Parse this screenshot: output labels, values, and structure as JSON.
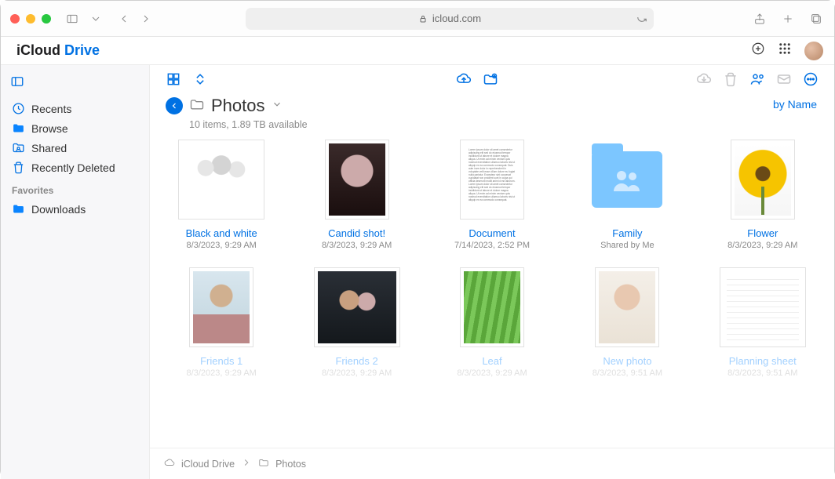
{
  "browser": {
    "address": "icloud.com"
  },
  "brand": {
    "word1": "iCloud",
    "word2": "Drive"
  },
  "sidebar": {
    "items": [
      {
        "label": "Recents"
      },
      {
        "label": "Browse"
      },
      {
        "label": "Shared"
      },
      {
        "label": "Recently Deleted"
      }
    ],
    "favorites_header": "Favorites",
    "favorites": [
      {
        "label": "Downloads"
      }
    ]
  },
  "page": {
    "title": "Photos",
    "subtitle": "10 items, 1.89 TB available",
    "sort_label": "by Name"
  },
  "files": [
    {
      "name": "Black and white",
      "meta": "8/3/2023, 9:29 AM"
    },
    {
      "name": "Candid shot!",
      "meta": "8/3/2023, 9:29 AM"
    },
    {
      "name": "Document",
      "meta": "7/14/2023, 2:52 PM"
    },
    {
      "name": "Family",
      "meta": "Shared by Me"
    },
    {
      "name": "Flower",
      "meta": "8/3/2023, 9:29 AM"
    },
    {
      "name": "Friends 1",
      "meta": "8/3/2023, 9:29 AM"
    },
    {
      "name": "Friends 2",
      "meta": "8/3/2023, 9:29 AM"
    },
    {
      "name": "Leaf",
      "meta": "8/3/2023, 9:29 AM"
    },
    {
      "name": "New photo",
      "meta": "8/3/2023, 9:51 AM"
    },
    {
      "name": "Planning sheet",
      "meta": "8/3/2023, 9:51 AM"
    }
  ],
  "breadcrumb": {
    "root": "iCloud Drive",
    "current": "Photos"
  },
  "doc_filler": "Lorem ipsum dolor sit amet consectetur adipiscing elit sed do eiusmod tempor incididunt ut labore et dolore magna aliqua. Ut enim ad minim veniam quis nostrud exercitation ullamco laboris nisi ut aliquip ex ea commodo consequat. Duis aute irure dolor in reprehenderit in voluptate velit esse cillum dolore eu fugiat nulla pariatur. Excepteur sint occaecat cupidatat non proident sunt in culpa qui officia deserunt mollit anim id est laborum. Lorem ipsum dolor sit amet consectetur adipiscing elit sed do eiusmod tempor incididunt ut labore et dolore magna aliqua. Ut enim ad minim veniam quis nostrud exercitation ullamco laboris nisi ut aliquip ex ea commodo consequat."
}
